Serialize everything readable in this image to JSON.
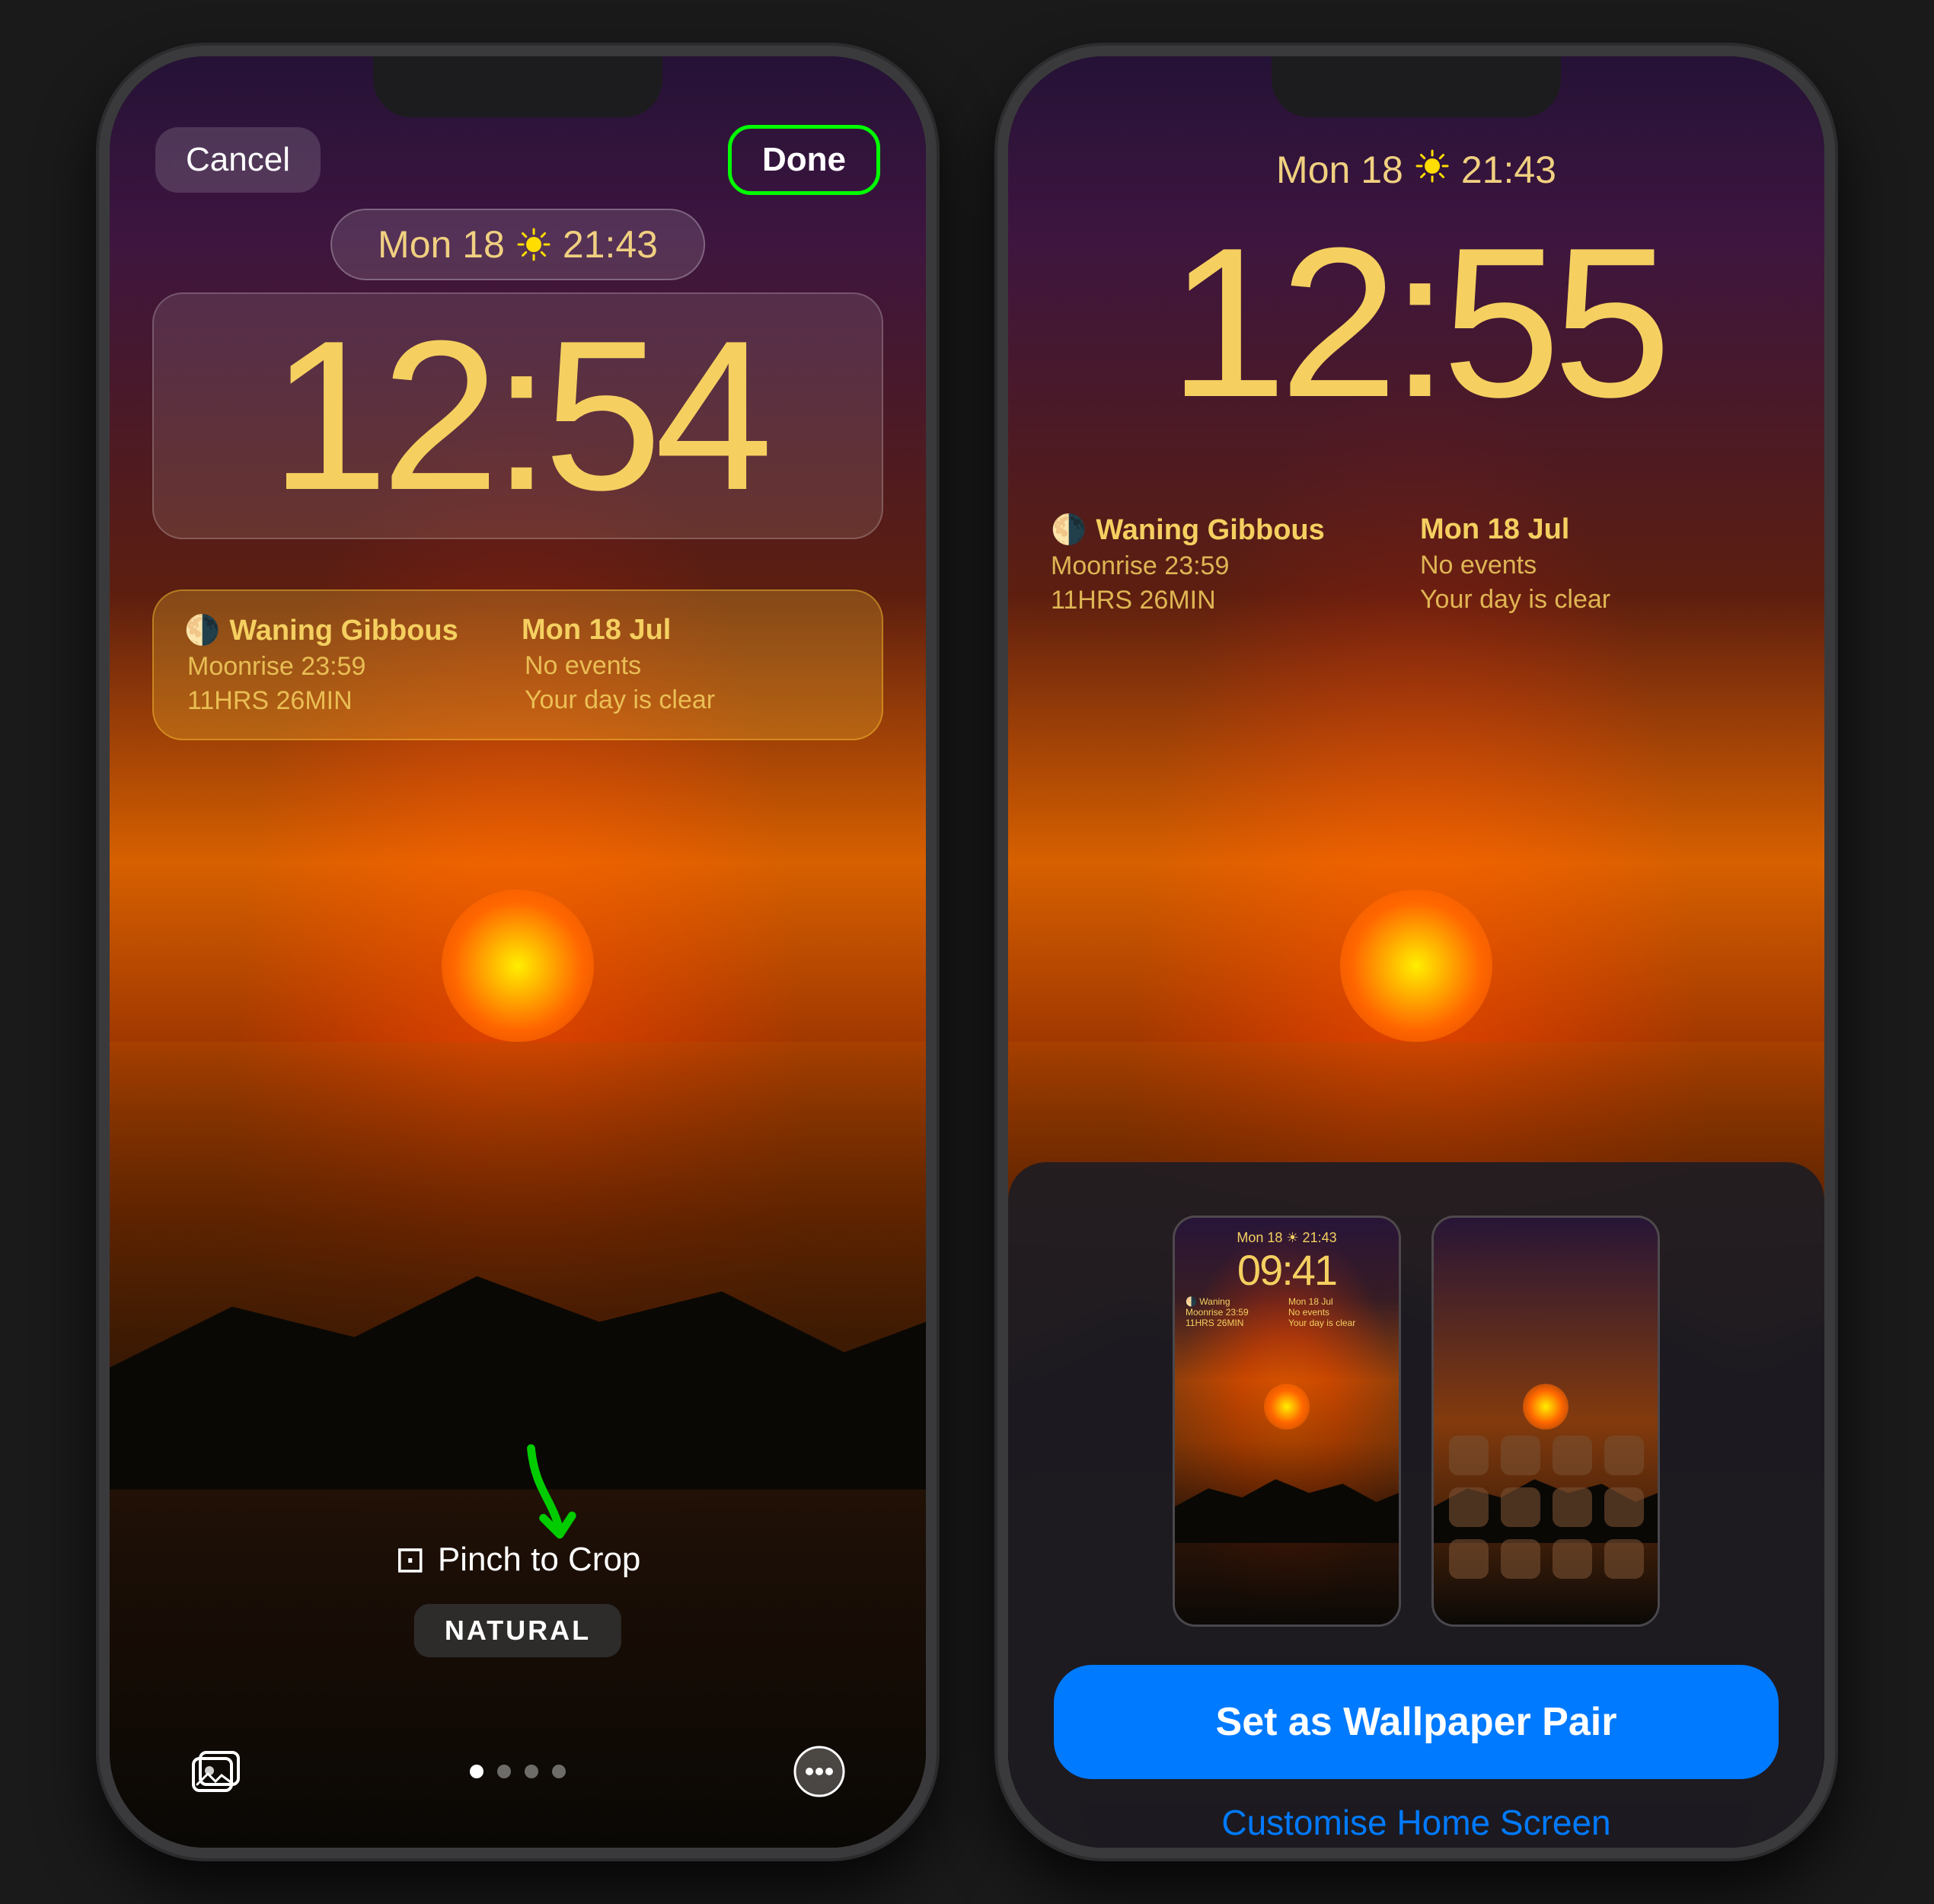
{
  "leftPhone": {
    "cancelButton": "Cancel",
    "doneButton": "Done",
    "dateWidget": {
      "text": "Mon 18",
      "sunSymbol": "☀",
      "time": "21:43"
    },
    "clockWidget": {
      "time": "12:54"
    },
    "infoWidget": {
      "leftTitle": "Waning Gibbous",
      "leftSub1": "Moonrise 23:59",
      "leftSub2": "11HRS 26MIN",
      "rightTitle": "Mon 18 Jul",
      "rightSub1": "No events",
      "rightSub2": "Your day is clear"
    },
    "pinchHint": "Pinch to Crop",
    "naturalBadge": "NATURAL",
    "toolbarDots": [
      "active",
      "inactive",
      "inactive",
      "inactive"
    ]
  },
  "rightPhone": {
    "dateWidget": {
      "text": "Mon 18",
      "sunSymbol": "☀",
      "time": "21:43"
    },
    "clockWidget": {
      "time": "12:55"
    },
    "infoWidget": {
      "leftTitle": "Waning Gibbous",
      "leftSub1": "Moonrise 23:59",
      "leftSub2": "11HRS 26MIN",
      "rightTitle": "Mon 18 Jul",
      "rightSub1": "No events",
      "rightSub2": "Your day is clear"
    },
    "bottomSheet": {
      "previewLockDate": "Mon 18  ☀ 21:43",
      "previewLockTime": "09:41",
      "setWallpaperBtn": "Set as Wallpaper Pair",
      "customiseBtn": "Customise Home Screen"
    }
  }
}
